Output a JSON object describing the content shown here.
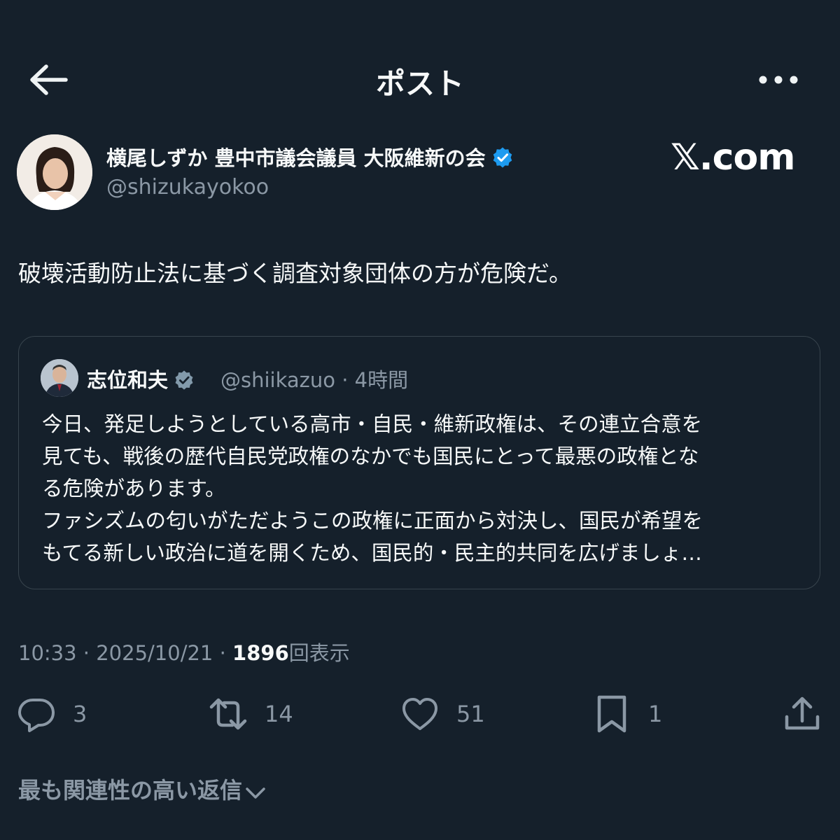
{
  "header": {
    "title": "ポスト",
    "back_icon": "arrow-left-icon",
    "more_icon": "more-horizontal-icon"
  },
  "author": {
    "display_name": "横尾しずか 豊中市議会議員 大阪維新の会",
    "handle": "@shizukayokoo",
    "verified": true,
    "badge_color": "#1d9bf0"
  },
  "watermark": "𝕏.com",
  "post": {
    "text": "破壊活動防止法に基づく調査対象団体の方が危険だ。"
  },
  "quoted_post": {
    "display_name": "志位和夫",
    "handle": "@shiikazuo",
    "separator": "·",
    "time": "4時間",
    "verified": true,
    "badge_color": "#829aab",
    "lines": [
      "今日、発足しようとしている高市・自民・維新政権は、その連立合意を",
      "見ても、戦後の歴代自民党政権のなかでも国民にとって最悪の政権とな",
      "る危険があります。",
      "ファシズムの匂いがただようこの政権に正面から対決し、国民が希望を",
      "もてる新しい政治に道を開くため、国民的・民主的共同を広げましょ…"
    ]
  },
  "meta": {
    "time": "10:33",
    "separator": "·",
    "date": "2025/10/21",
    "views": "1896",
    "views_label": "回表示"
  },
  "actions": {
    "reply": {
      "icon": "reply-icon",
      "count": "3"
    },
    "repost": {
      "icon": "repost-icon",
      "count": "14"
    },
    "like": {
      "icon": "heart-icon",
      "count": "51"
    },
    "bookmark": {
      "icon": "bookmark-icon",
      "count": "1"
    },
    "share": {
      "icon": "share-icon"
    }
  },
  "replies_sort": {
    "label": "最も関連性の高い返信",
    "icon": "chevron-down-icon"
  },
  "colors": {
    "background": "#15202b",
    "secondary_text": "#8b98a5",
    "border": "#38444d",
    "primary_text": "#e7e9ea"
  }
}
